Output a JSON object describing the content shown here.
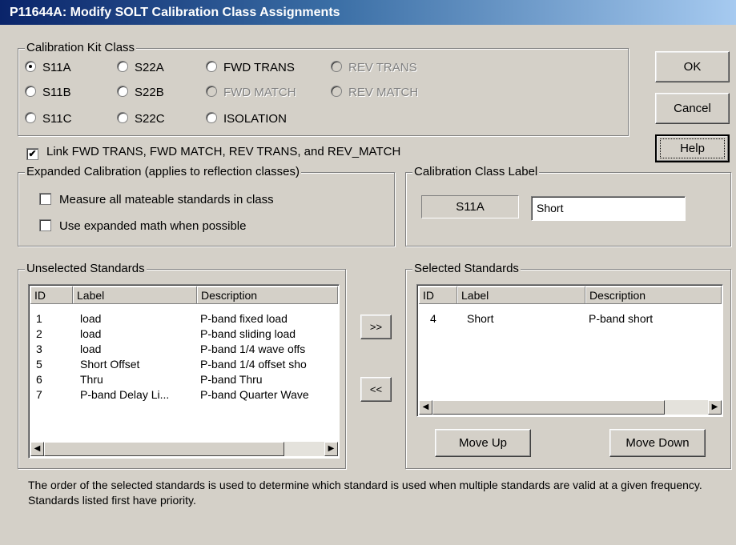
{
  "window": {
    "title": "P11644A: Modify SOLT Calibration Class Assignments"
  },
  "kit_class": {
    "legend": "Calibration Kit Class",
    "options": [
      {
        "label": "S11A",
        "selected": true,
        "enabled": true
      },
      {
        "label": "S11B",
        "selected": false,
        "enabled": true
      },
      {
        "label": "S11C",
        "selected": false,
        "enabled": true
      },
      {
        "label": "S22A",
        "selected": false,
        "enabled": true
      },
      {
        "label": "S22B",
        "selected": false,
        "enabled": true
      },
      {
        "label": "S22C",
        "selected": false,
        "enabled": true
      },
      {
        "label": "FWD TRANS",
        "selected": false,
        "enabled": true
      },
      {
        "label": "FWD MATCH",
        "selected": false,
        "enabled": false
      },
      {
        "label": "ISOLATION",
        "selected": false,
        "enabled": true
      },
      {
        "label": "REV TRANS",
        "selected": false,
        "enabled": false
      },
      {
        "label": "REV MATCH",
        "selected": false,
        "enabled": false
      }
    ]
  },
  "link_checkbox": {
    "label": "Link FWD TRANS, FWD MATCH, REV TRANS, and REV_MATCH",
    "checked": true
  },
  "expanded": {
    "legend": "Expanded Calibration (applies to reflection classes)",
    "measure_all": "Measure all mateable standards in class",
    "expanded_math": "Use expanded math when possible"
  },
  "class_label": {
    "legend": "Calibration Class Label",
    "current_class": "S11A",
    "value": "Short"
  },
  "buttons": {
    "ok": "OK",
    "cancel": "Cancel",
    "help": "Help",
    "add": ">>",
    "remove": "<<",
    "move_up": "Move Up",
    "move_down": "Move Down"
  },
  "unselected": {
    "legend": "Unselected Standards",
    "columns": [
      "ID",
      "Label",
      "Description"
    ],
    "rows": [
      [
        "1",
        "load",
        "P-band fixed load"
      ],
      [
        "2",
        "load",
        "P-band sliding load"
      ],
      [
        "3",
        "load",
        "P-band 1/4 wave offs"
      ],
      [
        "5",
        "Short Offset",
        "P-band 1/4 offset sho"
      ],
      [
        "6",
        "Thru",
        "P-band Thru"
      ],
      [
        "7",
        "P-band Delay Li...",
        "P-band Quarter Wave"
      ]
    ]
  },
  "selected": {
    "legend": "Selected Standards",
    "columns": [
      "ID",
      "Label",
      "Description"
    ],
    "rows": [
      [
        "4",
        "Short",
        "P-band short"
      ]
    ]
  },
  "note": "The order of the selected standards is used to determine which standard is used when multiple standards are valid at a given frequency. Standards listed first have priority.",
  "icons": {
    "scroll_left": "◀",
    "scroll_right": "▶",
    "check_mark": "✔"
  }
}
